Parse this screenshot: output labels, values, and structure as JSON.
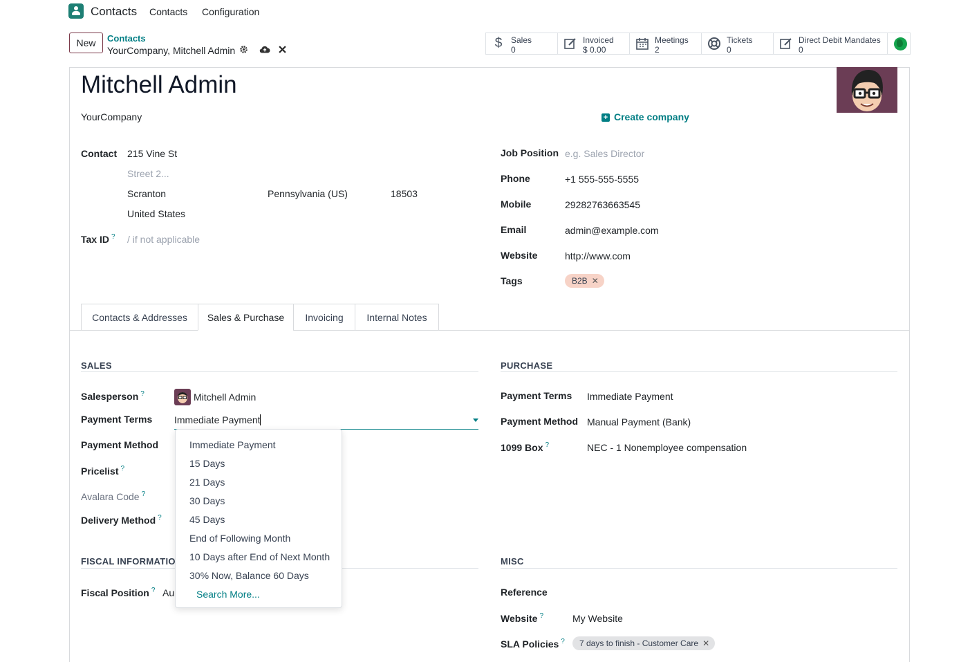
{
  "nav": {
    "app_name": "Contacts",
    "menu": [
      "Contacts",
      "Configuration"
    ]
  },
  "control_panel": {
    "new_label": "New",
    "breadcrumb_parent": "Contacts",
    "breadcrumb_current": "YourCompany, Mitchell Admin",
    "icons": [
      "gear-icon",
      "cloud-upload-icon",
      "close-icon"
    ]
  },
  "smart_buttons": [
    {
      "icon": "dollar-icon",
      "title": "Sales",
      "value": "0"
    },
    {
      "icon": "edit-icon",
      "title": "Invoiced",
      "value": "$ 0.00"
    },
    {
      "icon": "calendar-icon",
      "title": "Meetings",
      "value": "2"
    },
    {
      "icon": "lifebuoy-icon",
      "title": "Tickets",
      "value": "0"
    },
    {
      "icon": "edit-icon",
      "title": "Direct Debit Mandates",
      "value": "0"
    }
  ],
  "partner": {
    "name": "Mitchell Admin",
    "company": "YourCompany",
    "create_company_label": "Create company"
  },
  "address": {
    "label": "Contact",
    "street": "215 Vine St",
    "street2_placeholder": "Street 2...",
    "city": "Scranton",
    "state": "Pennsylvania (US)",
    "zip": "18503",
    "country": "United States",
    "tax_label": "Tax ID",
    "tax_sup": "?",
    "tax_placeholder": "/ if not applicable"
  },
  "right_fields": {
    "job_label": "Job Position",
    "job_placeholder": "e.g. Sales Director",
    "phone_label": "Phone",
    "phone": "+1 555-555-5555",
    "mobile_label": "Mobile",
    "mobile": "29282763663545",
    "email_label": "Email",
    "email": "admin@example.com",
    "website_label": "Website",
    "website": "http://www.com",
    "tags_label": "Tags",
    "tag": "B2B",
    "tag_color": "#f7d3c7"
  },
  "tabs": [
    "Contacts & Addresses",
    "Sales & Purchase",
    "Invoicing",
    "Internal Notes"
  ],
  "sales": {
    "title": "SALES",
    "salesperson_label": "Salesperson",
    "salesperson": "Mitchell Admin",
    "payment_terms_label": "Payment Terms",
    "payment_terms_value": "Immediate Payment",
    "payment_method_label": "Payment Method",
    "pricelist_label": "Pricelist",
    "avalara_label": "Avalara Code",
    "delivery_label": "Delivery Method",
    "sup": "?"
  },
  "dropdown": {
    "options": [
      "Immediate Payment",
      "15 Days",
      "21 Days",
      "30 Days",
      "45 Days",
      "End of Following Month",
      "10 Days after End of Next Month",
      "30% Now, Balance 60 Days"
    ],
    "search_more": "Search More..."
  },
  "fiscal": {
    "title": "FISCAL INFORMATION",
    "position_label": "Fiscal Position",
    "position_value": "Au"
  },
  "purchase": {
    "title": "PURCHASE",
    "payment_terms_label": "Payment Terms",
    "payment_terms": "Immediate Payment",
    "payment_method_label": "Payment Method",
    "payment_method": "Manual Payment (Bank)",
    "box_label": "1099 Box",
    "box": "NEC - 1 Nonemployee compensation"
  },
  "misc": {
    "title": "MISC",
    "reference_label": "Reference",
    "website_label": "Website",
    "website": "My Website",
    "sla_label": "SLA Policies",
    "sla": "7 days to finish - Customer Care",
    "sla_color": "#e2e3e5"
  },
  "colors": {
    "accent": "#017e84",
    "brand": "#714b67"
  }
}
